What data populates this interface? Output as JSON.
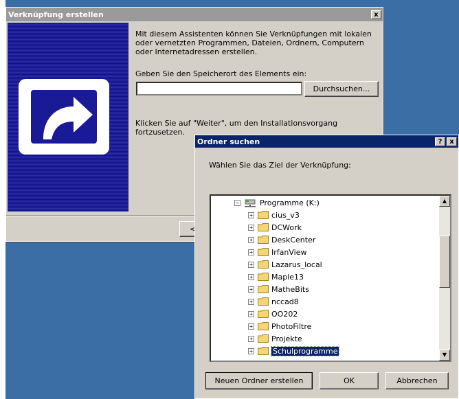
{
  "wizard": {
    "title": "Verknüpfung erstellen",
    "close_label": "x",
    "intro": "Mit diesem Assistenten können Sie Verknüpfungen mit lokalen oder vernetzten Programmen, Dateien, Ordnern, Computern oder Internetadressen erstellen.",
    "location_label": "Geben Sie den Speicherort des Elements ein:",
    "location_value": "",
    "browse_label": "Durchsuchen...",
    "next_hint": "Klicken Sie auf \"Weiter\", um den Installationsvorgang fortzusetzen.",
    "back_label": "<"
  },
  "dialog": {
    "title": "Ordner suchen",
    "help_label": "?",
    "close_label": "x",
    "prompt": "Wählen Sie das Ziel der Verknüpfung:",
    "root": {
      "label": "Programme (K:)",
      "icon": "network-drive-icon",
      "expander": "−"
    },
    "folders": [
      {
        "label": "cius_v3",
        "expander": "+"
      },
      {
        "label": "DCWork",
        "expander": "+"
      },
      {
        "label": "DeskCenter",
        "expander": "+"
      },
      {
        "label": "IrfanView",
        "expander": "+"
      },
      {
        "label": "Lazarus_local",
        "expander": "+"
      },
      {
        "label": "Maple13",
        "expander": "+"
      },
      {
        "label": "MatheBits",
        "expander": "+"
      },
      {
        "label": "nccad8",
        "expander": "+"
      },
      {
        "label": "OO202",
        "expander": "+"
      },
      {
        "label": "PhotoFiltre",
        "expander": "+"
      },
      {
        "label": "Projekte",
        "expander": "+"
      },
      {
        "label": "Schulprogramme",
        "expander": "+",
        "selected": true
      }
    ],
    "new_folder_label": "Neuen Ordner erstellen",
    "ok_label": "OK",
    "cancel_label": "Abbrechen"
  },
  "colors": {
    "titlebar_active": "#0a246a",
    "titlebar_inactive": "#9a9a9a",
    "face": "#d4d0c8",
    "desktop": "#3a6ea5",
    "folder": "#f4d774"
  }
}
